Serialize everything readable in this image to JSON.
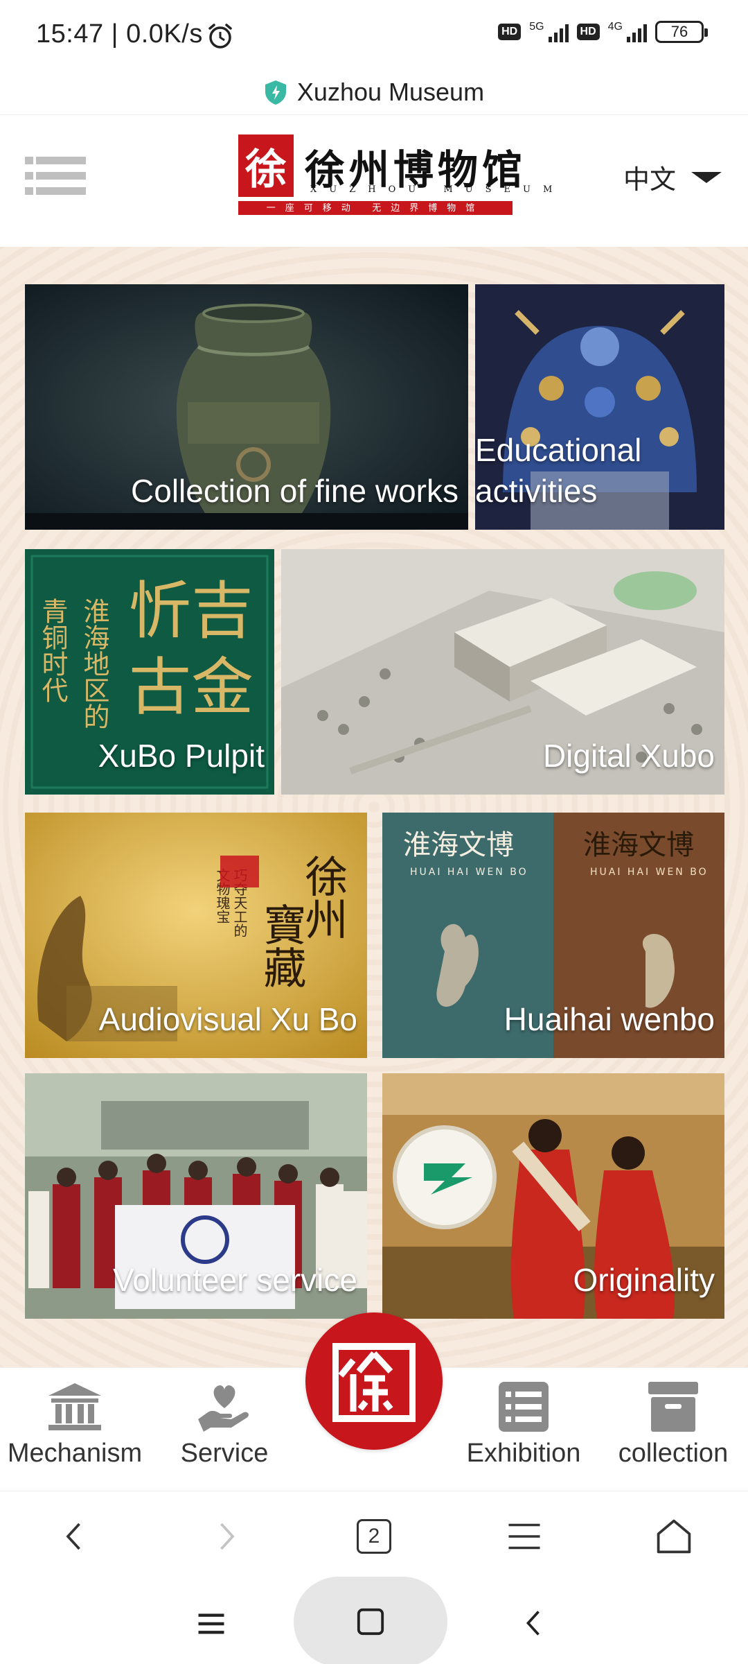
{
  "status_bar": {
    "time": "15:47",
    "speed": "0.0K/s",
    "hd1": "HD",
    "net1": "5G",
    "hd2": "HD",
    "net2": "4G",
    "battery": "76"
  },
  "url_bar": {
    "title": "Xuzhou Museum",
    "icon": "shield-icon"
  },
  "header": {
    "logo_cn": "徐州博物馆",
    "logo_en": "XUZHOU MUSEUM",
    "logo_slogan": "一座可移动 无边界博物馆",
    "logo_mark": "徐",
    "language": "中文",
    "brand_color": "#c8161d"
  },
  "tiles": [
    {
      "label": "Collection of fine works"
    },
    {
      "label": "Educational activities"
    },
    {
      "label": "XuBo Pulpit"
    },
    {
      "label": "Digital Xubo"
    },
    {
      "label": "Audiovisual Xu Bo"
    },
    {
      "label": "Huaihai wenbo"
    },
    {
      "label": "Volunteer service"
    },
    {
      "label": "Originality"
    }
  ],
  "bottom_nav": {
    "items": [
      {
        "label": "Mechanism",
        "icon": "institution-icon"
      },
      {
        "label": "Service",
        "icon": "heart-hand-icon"
      },
      {
        "label": "Exhibition",
        "icon": "list-icon"
      },
      {
        "label": "collection",
        "icon": "archive-icon"
      }
    ],
    "home_mark": "徐"
  },
  "browser_toolbar": {
    "tab_count": "2"
  }
}
